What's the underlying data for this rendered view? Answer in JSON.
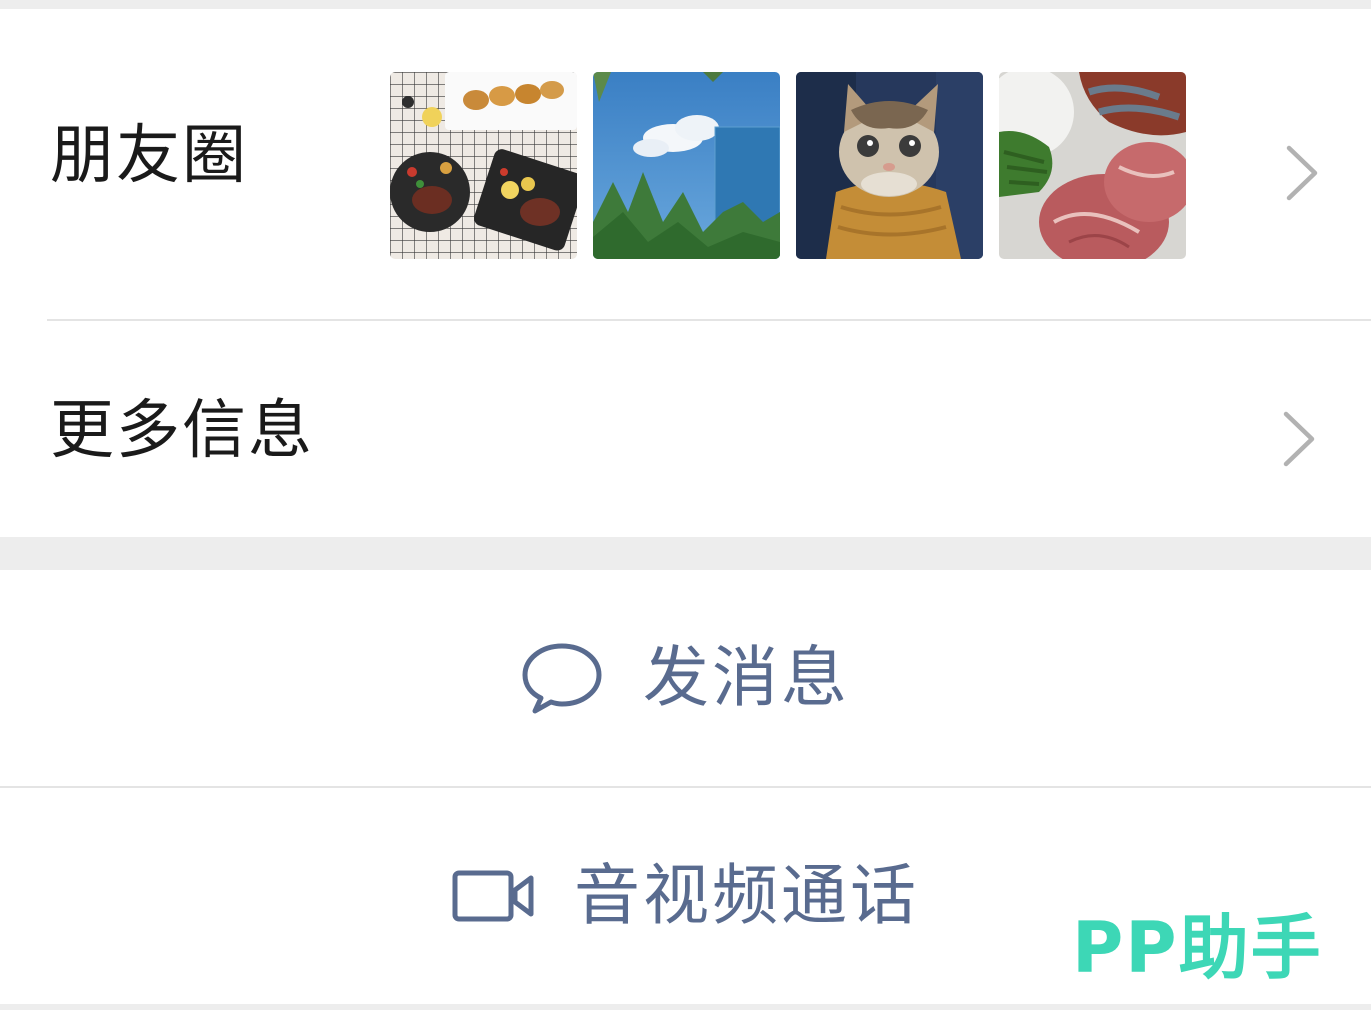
{
  "profile": {
    "moments": {
      "label": "朋友圈",
      "photos": [
        {
          "subject": "food-platter"
        },
        {
          "subject": "sky-trees-building"
        },
        {
          "subject": "cat-in-sweater"
        },
        {
          "subject": "raw-meat-vegetables"
        }
      ],
      "chevron_icon": "chevron-right-icon"
    },
    "more_info": {
      "label": "更多信息",
      "chevron_icon": "chevron-right-icon"
    }
  },
  "actions": {
    "send_message": {
      "label": "发消息",
      "icon": "chat-bubble-icon"
    },
    "video_call": {
      "label": "音视频通话",
      "icon": "video-camera-icon"
    }
  },
  "watermark": {
    "text": "PP助手"
  },
  "colors": {
    "background": "#ededed",
    "card": "#ffffff",
    "text_primary": "#1a1a1a",
    "action_text": "#596b8f",
    "chevron": "#b2b2b2",
    "divider": "#e4e4e4",
    "watermark": "#3dd7b6"
  }
}
